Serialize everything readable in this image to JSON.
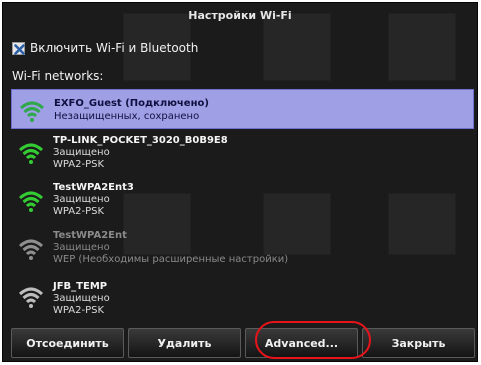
{
  "window": {
    "title": "Настройки Wi-Fi"
  },
  "toggle": {
    "label": "Включить Wi-Fi и Bluetooth",
    "checked": true
  },
  "section": {
    "label": "Wi-Fi networks:"
  },
  "networks": [
    {
      "name": "EXFO_Guest (Подключено)",
      "line1": "Незащищенных, сохранено",
      "line2": "",
      "signal_color": "#2ea84a",
      "selected": true
    },
    {
      "name": "TP-LINK_POCKET_3020_B0B9E8",
      "line1": "Защищено",
      "line2": "WPA2-PSK",
      "signal_color": "#33cc33",
      "selected": false
    },
    {
      "name": "TestWPA2Ent3",
      "line1": "Защищено",
      "line2": "WPA2-PSK",
      "signal_color": "#33cc33",
      "selected": false
    },
    {
      "name": "TestWPA2Ent",
      "line1": "Защищено",
      "line2": "WEP (Необходимы расширенные настройки)",
      "signal_color": "#8f8f8f",
      "selected": false
    },
    {
      "name": "JFB_TEMP",
      "line1": "Защищено",
      "line2": "WPA2-PSK",
      "signal_color": "#bdbdbd",
      "selected": false
    }
  ],
  "buttons": {
    "disconnect": "Отсоединить",
    "delete": "Удалить",
    "advanced": "Advanced...",
    "close": "Закрыть"
  },
  "colors": {
    "selected_row": "#9f9fe6",
    "annotation_ring": "#e8141c"
  }
}
